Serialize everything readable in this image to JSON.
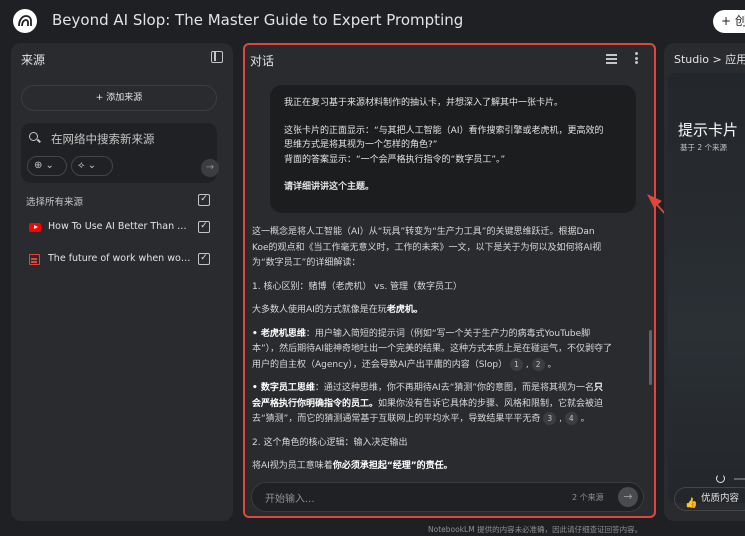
{
  "header": {
    "title": "Beyond AI Slop: The Master Guide to Expert Prompting",
    "create_label": "+ 创"
  },
  "sources": {
    "panel_title": "来源",
    "add_source_label": "+ 添加来源",
    "search_placeholder": "在网络中搜索新来源",
    "chip_web": "⊕ ⌄",
    "chip_research": "⟡ ⌄",
    "select_all_label": "选择所有来源",
    "items": [
      {
        "title": "How To Use AI Better Than 99% ...",
        "type": "youtube"
      },
      {
        "title": "The future of work when work is ...",
        "type": "doc"
      }
    ]
  },
  "chat": {
    "panel_title": "对话",
    "user_message": [
      "我正在复习基于来源材料制作的抽认卡，并想深入了解其中一张卡片。",
      "",
      "这张卡片的正面显示：“与其把人工智能（AI）看作搜索引擎或老虎机，更高效的",
      "思维方式是将其视为一个怎样的角色?”",
      "背面的答案显示：“一个会严格执行指令的“数字员工”。”",
      "",
      "请详细讲讲这个主题。"
    ],
    "response": {
      "intro": "这一概念是将人工智能（AI）从“玩具”转变为“生产力工具”的关键思维跃迁。根据Dan Koe的观点和《当工作毫无意义时，工作的未来》一文，以下是关于为何以及如何将AI视为“数字员工”的详细解读：",
      "h1": "1. 核心区别：赌博（老虎机） vs. 管理（数字员工）",
      "p1_pre": "大多数人使用AI的方式就像是在玩",
      "p1_bold": "老虎机。",
      "b1_bold": "• 老虎机思维",
      "b1_text": "：用户输入简短的提示词（例如“写一个关于生产力的病毒式YouTube脚本”），然后期待AI能神奇地吐出一个完美的结果。这种方式本质上是在碰运气，不仅剥夺了用户的自主权（Agency），还会导致AI产出平庸的内容（Slop）",
      "cite1": "1",
      "cite2": "2",
      "b2_bold": "• 数字员工思维",
      "b2_text1": "：通过这种思维，你不再期待AI去“猜测”你的意图，而是将其视为一名",
      "b2_bold2": "只会严格执行你明确指令的员工。",
      "b2_text2": "如果你没有告诉它具体的步骤、风格和限制，它就会被迫去“猜测”，而它的猜测通常基于互联网上的平均水平，导致结果平平无奇",
      "cite3": "3",
      "cite4": "4",
      "h2": "2. 这个角色的核心逻辑：输入决定输出",
      "p2_pre": "将AI视为员工意味着",
      "p2_bold": "你必须承担起“经理”的责任。"
    },
    "input_placeholder": "开始输入...",
    "source_count": "2 个来源",
    "send_icon": "→"
  },
  "studio": {
    "breadcrumb": "Studio > 应用",
    "card_title": "提示卡片",
    "card_subtitle": "基于 2 个来源",
    "like_label": "优质内容"
  },
  "footer": {
    "disclaimer": "NotebookLM 提供的内容未必准确，因此请仔细查证回答内容。"
  },
  "colors": {
    "background": "#1f2023",
    "panel": "#2a2b2e",
    "highlight_border": "#e0473a",
    "youtube": "#ff0000"
  }
}
